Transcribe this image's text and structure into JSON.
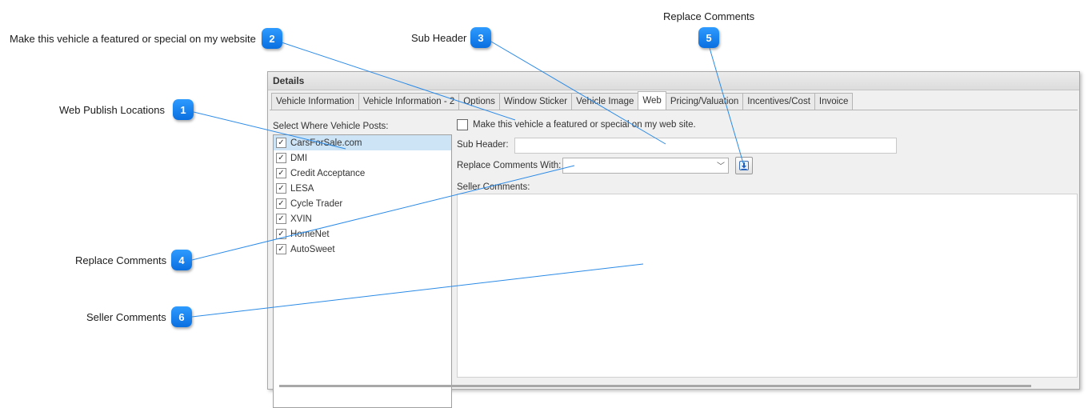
{
  "callouts": [
    {
      "num": "1",
      "label": "Web Publish Locations"
    },
    {
      "num": "2",
      "label": "Make this vehicle a featured or special on my website"
    },
    {
      "num": "3",
      "label": "Sub Header"
    },
    {
      "num": "4",
      "label": "Replace Comments"
    },
    {
      "num": "5",
      "label": "Replace Comments"
    },
    {
      "num": "6",
      "label": "Seller Comments"
    }
  ],
  "panel": {
    "title": "Details",
    "tabs": [
      {
        "label": "Vehicle Information"
      },
      {
        "label": "Vehicle Information - 2"
      },
      {
        "label": "Options"
      },
      {
        "label": "Window Sticker"
      },
      {
        "label": "Vehicle Image"
      },
      {
        "label": "Web"
      },
      {
        "label": "Pricing/Valuation"
      },
      {
        "label": "Incentives/Cost"
      },
      {
        "label": "Invoice"
      }
    ],
    "active_tab": "Web"
  },
  "web": {
    "posts_label": "Select Where Vehicle Posts:",
    "posts": [
      {
        "label": "CarsForSale.com",
        "checked": true,
        "selected": true
      },
      {
        "label": "DMI",
        "checked": true
      },
      {
        "label": "Credit Acceptance",
        "checked": true
      },
      {
        "label": "LESA",
        "checked": true
      },
      {
        "label": "Cycle Trader",
        "checked": true
      },
      {
        "label": "XVIN",
        "checked": true
      },
      {
        "label": "HomeNet",
        "checked": true
      },
      {
        "label": "AutoSweet",
        "checked": true
      }
    ],
    "featured_label": "Make this vehicle a featured or special on my web site.",
    "featured_checked": false,
    "sub_header_label": "Sub Header:",
    "sub_header_value": "",
    "replace_label": "Replace Comments With:",
    "replace_value": "",
    "seller_comments_label": "Seller Comments:",
    "seller_comments_value": ""
  },
  "colors": {
    "badge": "#1a86f5",
    "callout_line": "#2a8ae6",
    "selected_row": "#cde4f7"
  }
}
